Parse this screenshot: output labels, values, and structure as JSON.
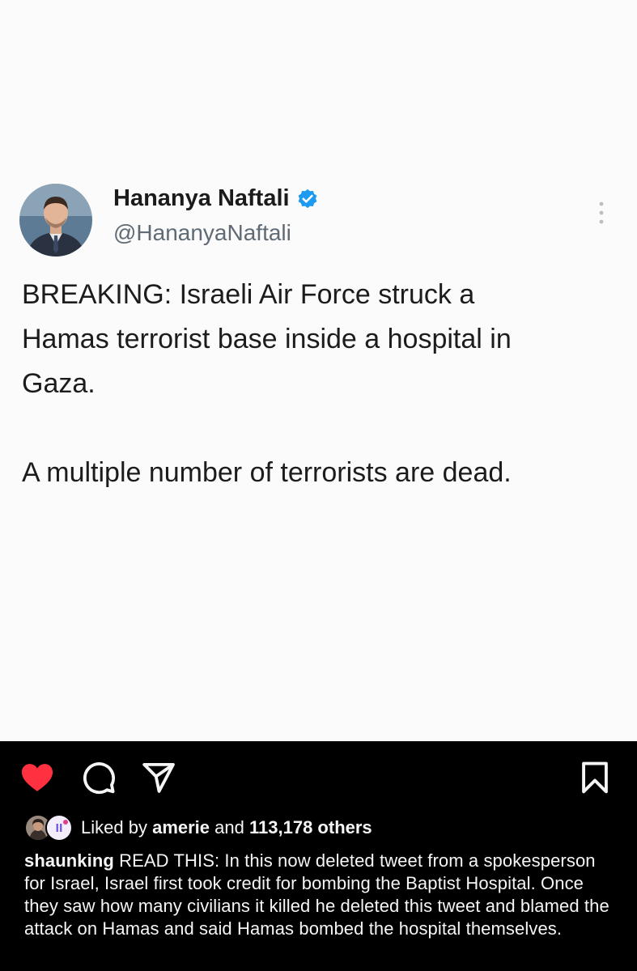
{
  "post": {
    "tweet": {
      "display_name": "Hananya Naftali",
      "handle": "@HananyaNaftali",
      "text": "BREAKING: Israeli Air Force struck a\nHamas terrorist base inside a hospital in\nGaza.\n\nA multiple number of terrorists are dead.",
      "icons": {
        "verified": "verified-badge-icon",
        "more": "more-options-icon"
      }
    }
  },
  "actions": {
    "like_icon": "heart-icon-filled",
    "comment_icon": "comment-icon",
    "share_icon": "share-icon",
    "save_icon": "bookmark-icon"
  },
  "likes": {
    "prefix": "Liked by",
    "user": "amerie",
    "conjunction": "and",
    "others": "113,178 others"
  },
  "caption": {
    "username": "shaunking",
    "text": "READ THIS: In this now deleted tweet from a spokesperson for Israel, Israel first took credit for bombing the Baptist Hospital. Once they saw how many civilians it killed he deleted this tweet and blamed the attack on Hamas and said Hamas bombed the hospital themselves."
  },
  "colors": {
    "like_red": "#ff3040",
    "verified_blue": "#1d9bf0",
    "app_background": "#000000",
    "image_background": "#fbfbfb"
  }
}
